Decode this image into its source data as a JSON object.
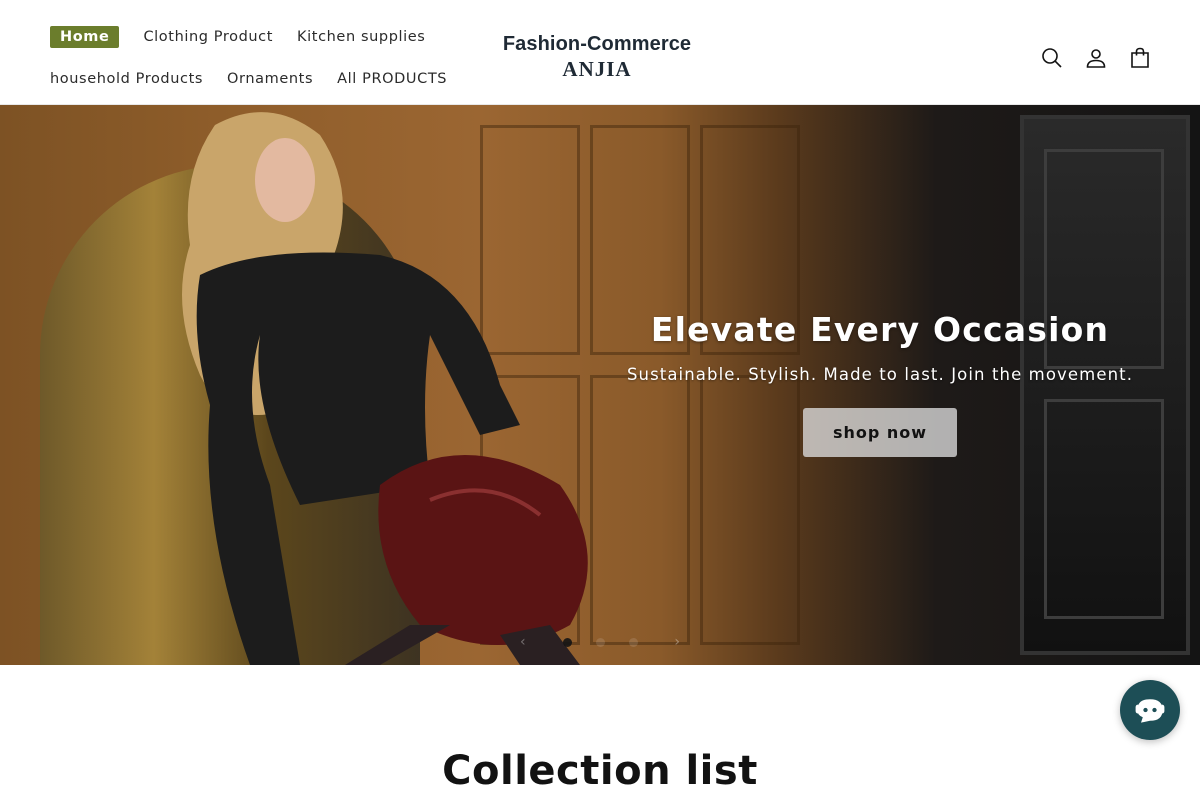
{
  "header": {
    "nav_row1": [
      "Home",
      "Clothing Product",
      "Kitchen supplies"
    ],
    "nav_row2": [
      "household Products",
      "Ornaments",
      "All PRODUCTS"
    ],
    "logo_line1": "Fashion-Commerce",
    "logo_line2": "ANJIA",
    "icons": [
      "search-icon",
      "account-icon",
      "cart-icon"
    ]
  },
  "hero": {
    "title": "Elevate Every Occasion",
    "subtitle": "Sustainable. Stylish. Made to last. Join the movement.",
    "button_label": "shop now",
    "slides_count": 3,
    "active_slide": 1
  },
  "collection": {
    "title": "Collection list"
  },
  "colors": {
    "accent": "#6b7d2c",
    "chat": "#1d4e56"
  }
}
